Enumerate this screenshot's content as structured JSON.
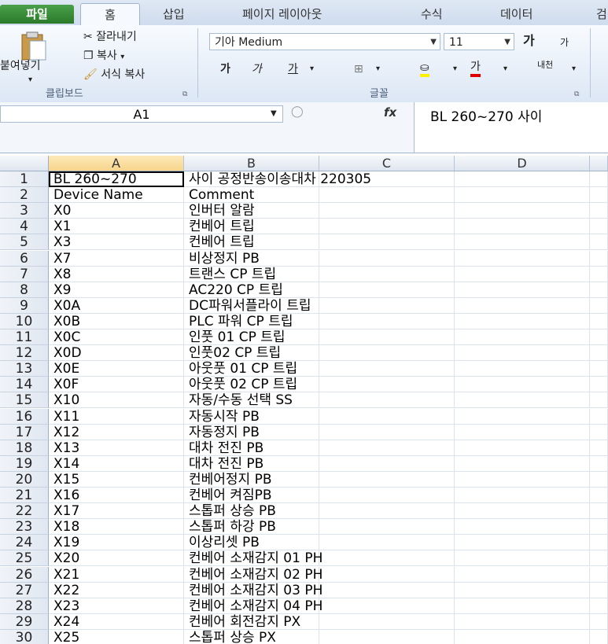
{
  "tabs": [
    "파일",
    "홈",
    "삽입",
    "페이지 레이아웃",
    "수식",
    "데이터",
    "검"
  ],
  "clipboard": {
    "paste": "붙여넣기",
    "cut": "잘라내기",
    "copy": "복사",
    "format_painter": "서식 복사",
    "group_label": "클립보드"
  },
  "font": {
    "name": "기아 Medium",
    "size": "11",
    "grow": "가",
    "shrink": "가",
    "bold": "가",
    "italic": "가",
    "underline": "가",
    "color_letter": "가",
    "wrap": "내천",
    "group_label": "글꼴"
  },
  "name_box": "A1",
  "fx_label": "fx",
  "formula": "BL 260~270 사이",
  "columns": [
    "A",
    "B",
    "C",
    "D"
  ],
  "rows": [
    {
      "n": "1",
      "a": "BL 260~270",
      "b": "사이 공정반송이송대차 220305"
    },
    {
      "n": "2",
      "a": "Device Name",
      "b": "Comment"
    },
    {
      "n": "3",
      "a": "X0",
      "b": "인버터 알람"
    },
    {
      "n": "4",
      "a": "X1",
      "b": "컨베어 트립"
    },
    {
      "n": "5",
      "a": "X3",
      "b": "컨베어 트립"
    },
    {
      "n": "6",
      "a": "X7",
      "b": "비상정지 PB"
    },
    {
      "n": "7",
      "a": "X8",
      "b": "트랜스 CP 트립"
    },
    {
      "n": "8",
      "a": "X9",
      "b": "AC220 CP 트립"
    },
    {
      "n": "9",
      "a": "X0A",
      "b": "DC파워서플라이 트립"
    },
    {
      "n": "10",
      "a": "X0B",
      "b": "PLC 파워 CP 트립"
    },
    {
      "n": "11",
      "a": "X0C",
      "b": "인풋 01 CP 트립"
    },
    {
      "n": "12",
      "a": "X0D",
      "b": "인풋02 CP 트립"
    },
    {
      "n": "13",
      "a": "X0E",
      "b": "아웃풋 01 CP 트립"
    },
    {
      "n": "14",
      "a": "X0F",
      "b": "아웃풋 02 CP 트립"
    },
    {
      "n": "15",
      "a": "X10",
      "b": "자동/수동 선택 SS"
    },
    {
      "n": "16",
      "a": "X11",
      "b": "자동시작 PB"
    },
    {
      "n": "17",
      "a": "X12",
      "b": "자동정지 PB"
    },
    {
      "n": "18",
      "a": "X13",
      "b": "대차 전진 PB"
    },
    {
      "n": "19",
      "a": "X14",
      "b": "대차 전진 PB"
    },
    {
      "n": "20",
      "a": "X15",
      "b": "컨베어정지 PB"
    },
    {
      "n": "21",
      "a": "X16",
      "b": "컨베어 켜짐PB"
    },
    {
      "n": "22",
      "a": "X17",
      "b": "스톱퍼 상승 PB"
    },
    {
      "n": "23",
      "a": "X18",
      "b": "스톱퍼 하강 PB"
    },
    {
      "n": "24",
      "a": "X19",
      "b": "이상리셋 PB"
    },
    {
      "n": "25",
      "a": "X20",
      "b": "컨베어 소재감지 01 PH"
    },
    {
      "n": "26",
      "a": "X21",
      "b": "컨베어 소재감지 02 PH"
    },
    {
      "n": "27",
      "a": "X22",
      "b": "컨베어 소재감지 03 PH"
    },
    {
      "n": "28",
      "a": "X23",
      "b": "컨베어 소재감지 04 PH"
    },
    {
      "n": "29",
      "a": "X24",
      "b": "컨베어 회전감지 PX"
    },
    {
      "n": "30",
      "a": "X25",
      "b": "스톱퍼 상승 PX"
    }
  ]
}
